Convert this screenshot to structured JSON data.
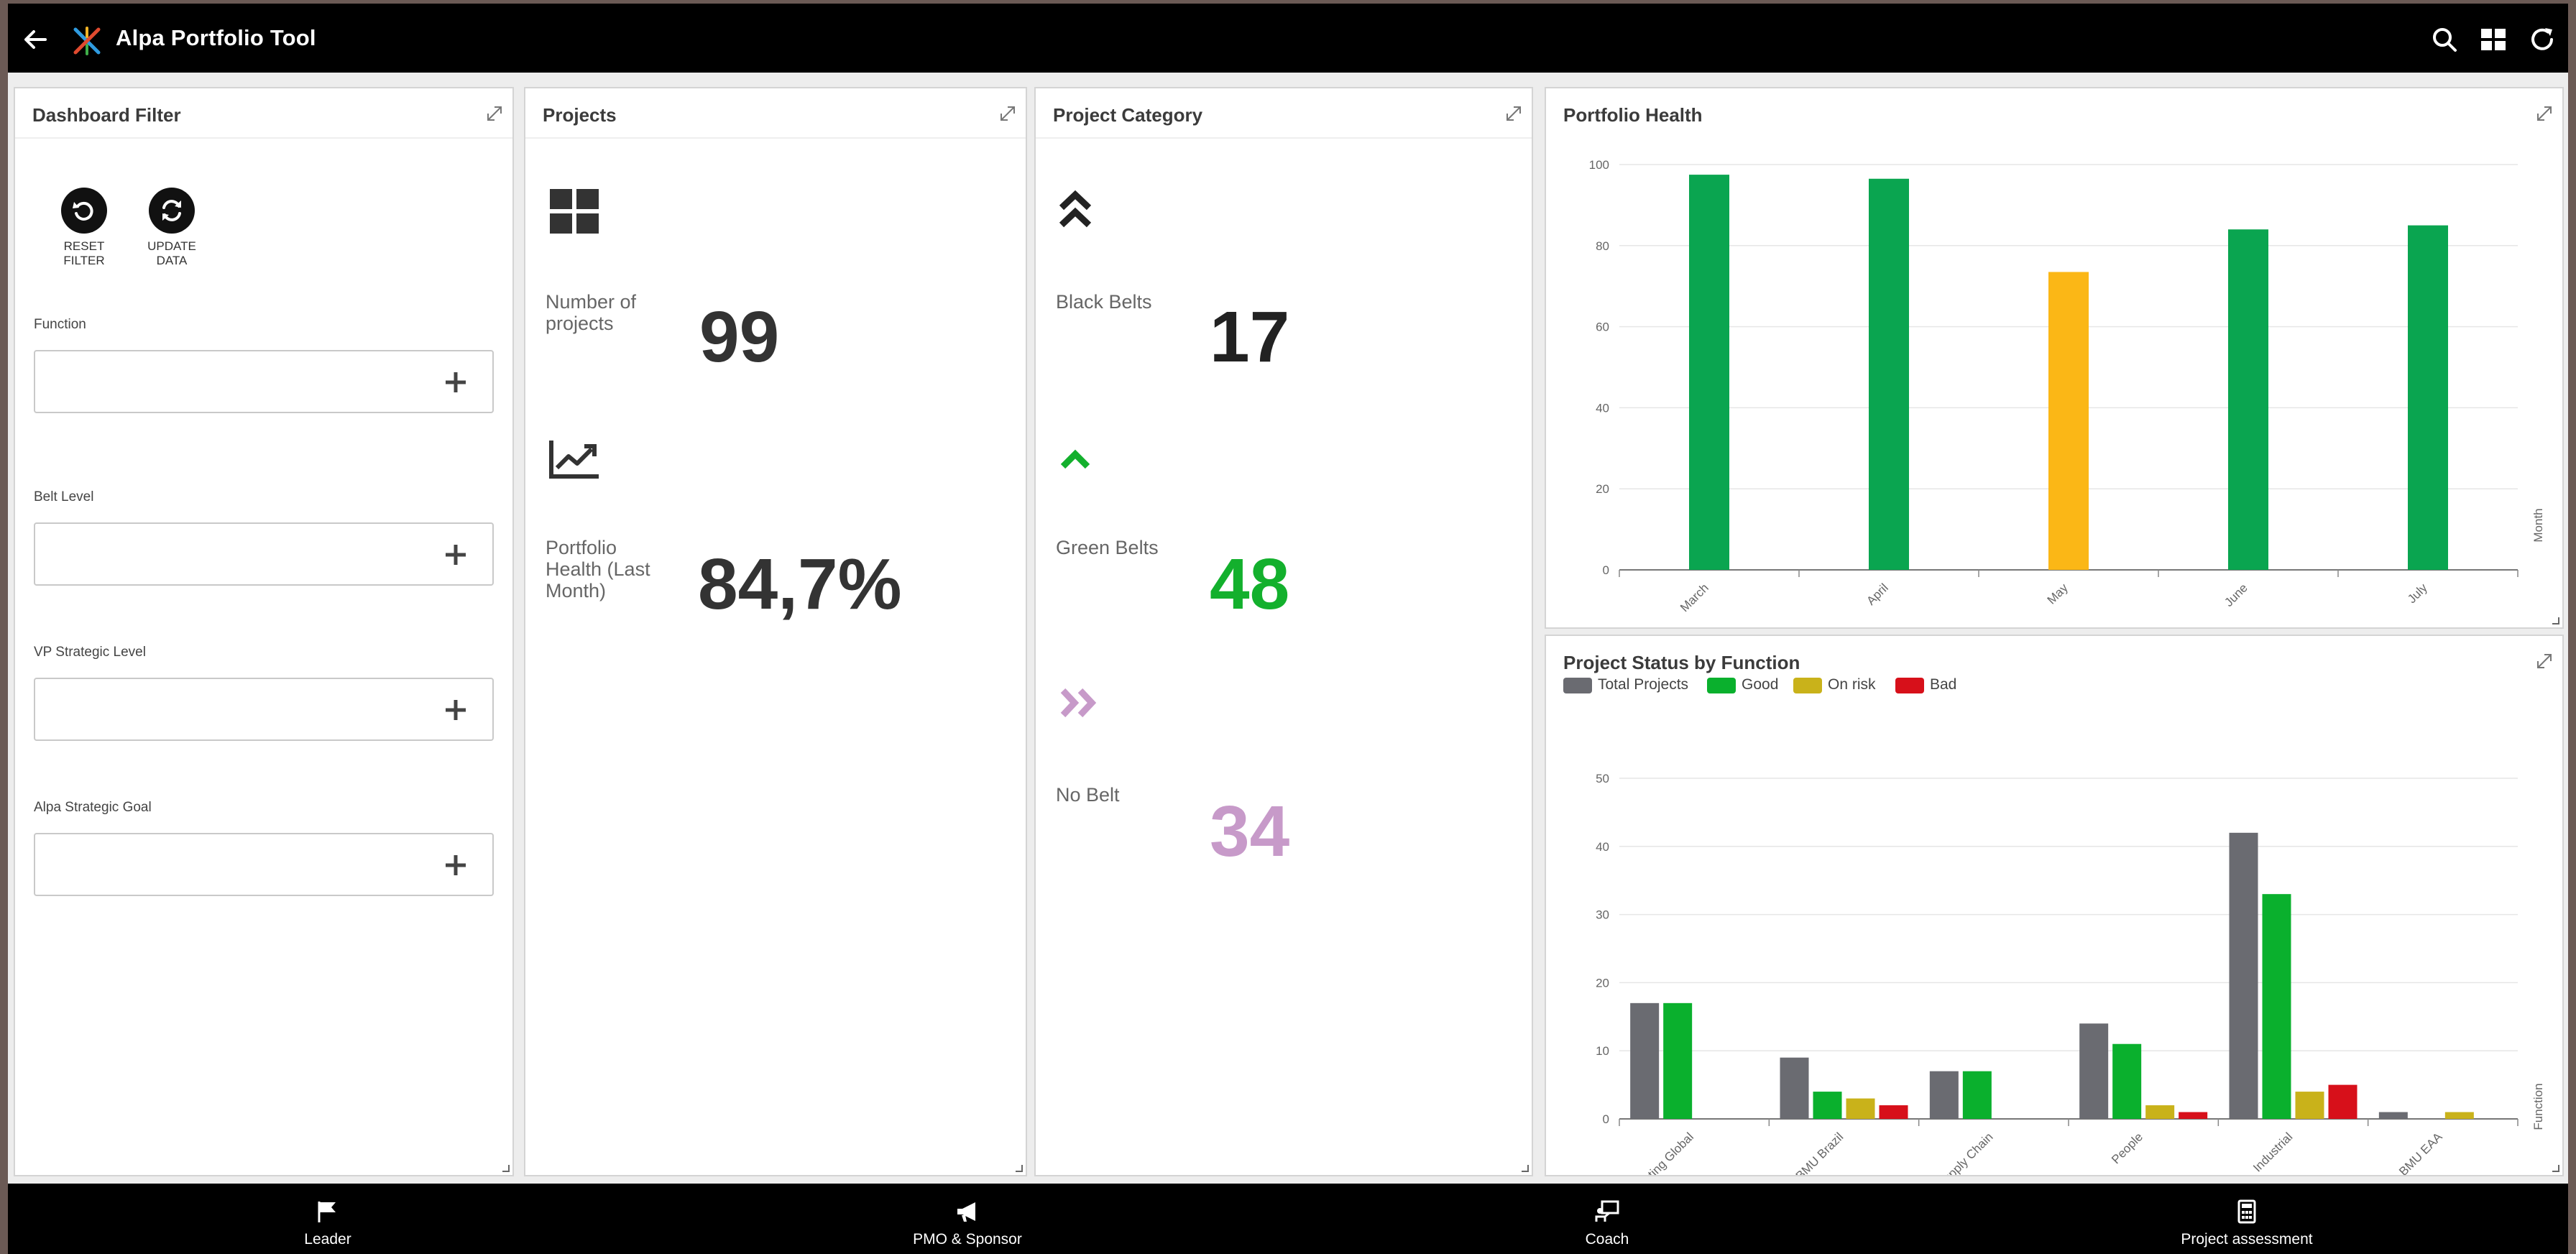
{
  "app": {
    "title": "Alpa Portfolio Tool"
  },
  "filter_panel": {
    "title": "Dashboard Filter",
    "reset_label_1": "RESET",
    "reset_label_2": "FILTER",
    "update_label_1": "UPDATE",
    "update_label_2": "DATA",
    "fields": [
      {
        "label": "Function",
        "value": ""
      },
      {
        "label": "Belt Level",
        "value": ""
      },
      {
        "label": "VP Strategic Level",
        "value": ""
      },
      {
        "label": "Alpa Strategic Goal",
        "value": ""
      }
    ]
  },
  "projects_panel": {
    "title": "Projects",
    "count_label_1": "Number of",
    "count_label_2": "projects",
    "count_value": "99",
    "health_label_1": "Portfolio",
    "health_label_2": "Health (Last",
    "health_label_3": "Month)",
    "health_value": "84,7%"
  },
  "category_panel": {
    "title": "Project Category",
    "items": [
      {
        "label": "Black Belts",
        "value": "17",
        "color": "#222222",
        "icon": "double-chevron-up-icon"
      },
      {
        "label": "Green Belts",
        "value": "48",
        "color": "#13b02d",
        "icon": "chevron-up-icon"
      },
      {
        "label": "No Belt",
        "value": "34",
        "color": "#c79ac9",
        "icon": "double-chevron-right-icon"
      }
    ]
  },
  "chart_data": [
    {
      "type": "bar",
      "title": "Portfolio Health",
      "xlabel": "Month",
      "ylabel": "",
      "categories": [
        "March",
        "April",
        "May",
        "June",
        "July"
      ],
      "values": [
        97.5,
        96.5,
        73.5,
        84,
        85
      ],
      "colors": [
        "#0aa550",
        "#0aa550",
        "#fbb716",
        "#0aa550",
        "#0aa550"
      ],
      "yticks": [
        "0",
        "20",
        "40",
        "60",
        "80",
        "100"
      ],
      "ylim": [
        0,
        100
      ],
      "grid": true
    },
    {
      "type": "bar",
      "title": "Project Status by Function",
      "xlabel": "Function",
      "ylabel": "",
      "categories": [
        "Marketing Global",
        "BMU Brazil",
        "Supply Chain",
        "People",
        "Industrial",
        "BMU EAA"
      ],
      "series": [
        {
          "name": "Total Projects",
          "color": "#6a6b71",
          "values": [
            17,
            9,
            7,
            14,
            42,
            1
          ]
        },
        {
          "name": "Good",
          "color": "#0ab02d",
          "values": [
            17,
            4,
            7,
            11,
            33,
            0
          ]
        },
        {
          "name": "On risk",
          "color": "#c9b21a",
          "values": [
            0,
            3,
            0,
            2,
            4,
            1
          ]
        },
        {
          "name": "Bad",
          "color": "#d7101a",
          "values": [
            0,
            2,
            0,
            1,
            5,
            0
          ]
        }
      ],
      "yticks": [
        "0",
        "10",
        "20",
        "30",
        "40",
        "50"
      ],
      "ylim": [
        0,
        50
      ],
      "legend": "top-left",
      "grid": true
    }
  ],
  "bottom_nav": [
    {
      "label": "Leader",
      "icon": "flag-icon"
    },
    {
      "label": "PMO & Sponsor",
      "icon": "megaphone-icon"
    },
    {
      "label": "Coach",
      "icon": "presentation-icon"
    },
    {
      "label": "Project assessment",
      "icon": "calculator-icon"
    }
  ]
}
